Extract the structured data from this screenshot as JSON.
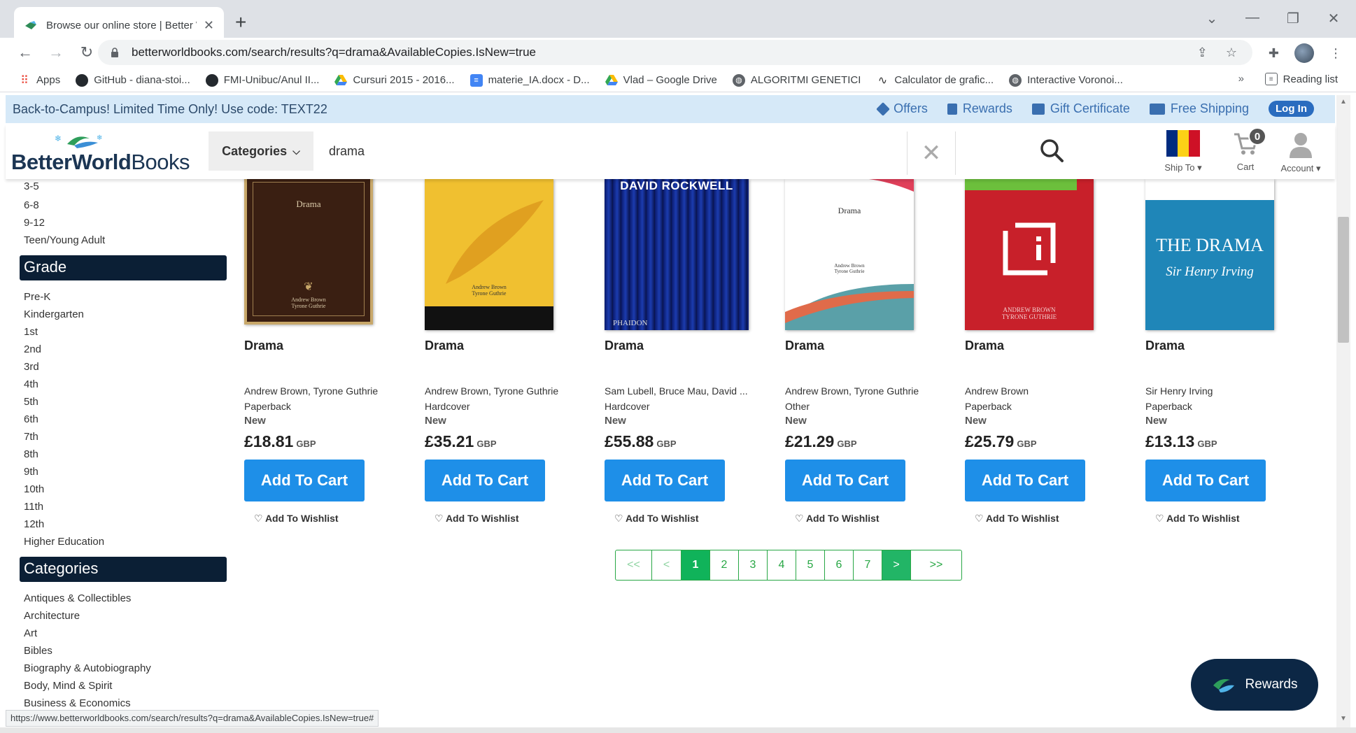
{
  "browser": {
    "tab_title": "Browse our online store | Better W",
    "url": "betterworldbooks.com/search/results?q=drama&AvailableCopies.IsNew=true",
    "bookmarks": [
      {
        "label": "Apps",
        "icon": "apps-grid-icon"
      },
      {
        "label": "GitHub - diana-stoi...",
        "icon": "github-icon"
      },
      {
        "label": "FMI-Unibuc/Anul II...",
        "icon": "github-icon"
      },
      {
        "label": "Cursuri 2015 - 2016...",
        "icon": "google-drive-icon"
      },
      {
        "label": "materie_IA.docx - D...",
        "icon": "google-docs-icon"
      },
      {
        "label": "Vlad – Google Drive",
        "icon": "google-drive-icon"
      },
      {
        "label": "ALGORITMI GENETICI",
        "icon": "globe-icon"
      },
      {
        "label": "Calculator de grafic...",
        "icon": "desmos-icon"
      },
      {
        "label": "Interactive Voronoi...",
        "icon": "globe-icon"
      }
    ],
    "bookmarks_overflow": "»",
    "reading_list": "Reading list",
    "status_url": "https://www.betterworldbooks.com/search/results?q=drama&AvailableCopies.IsNew=true#"
  },
  "promo": {
    "text": "Back-to-Campus! Limited Time Only! Use code: TEXT22",
    "links": [
      "Offers",
      "Rewards",
      "Gift Certificate",
      "Free Shipping"
    ],
    "login": "Log In"
  },
  "header": {
    "logo_bold": "BetterWorld",
    "logo_thin": "Books",
    "categories_label": "Categories",
    "search_value": "drama",
    "ship_to": "Ship To",
    "cart_label": "Cart",
    "cart_count": "0",
    "account_label": "Account"
  },
  "sidebar": {
    "age_items": [
      "3-5",
      "6-8",
      "9-12",
      "Teen/Young Adult"
    ],
    "grade_heading": "Grade",
    "grade_items": [
      "Pre-K",
      "Kindergarten",
      "1st",
      "2nd",
      "3rd",
      "4th",
      "5th",
      "6th",
      "7th",
      "8th",
      "9th",
      "10th",
      "11th",
      "12th",
      "Higher Education"
    ],
    "categories_heading": "Categories",
    "category_items": [
      "Antiques & Collectibles",
      "Architecture",
      "Art",
      "Bibles",
      "Biography & Autobiography",
      "Body, Mind & Spirit",
      "Business & Economics"
    ]
  },
  "products": [
    {
      "title": "Drama",
      "author": "Andrew Brown, Tyrone Guthrie",
      "binding": "Paperback",
      "condition": "New",
      "price": "£18.81",
      "currency": "GBP",
      "cart": "Add To Cart",
      "wishlist": "Add To Wishlist",
      "cover_title": "Drama",
      "cover_author": "Andrew Brown\nTyrone Guthrie"
    },
    {
      "title": "Drama",
      "author": "Andrew Brown, Tyrone Guthrie",
      "binding": "Hardcover",
      "condition": "New",
      "price": "£35.21",
      "currency": "GBP",
      "cart": "Add To Cart",
      "wishlist": "Add To Wishlist",
      "cover_title": "",
      "cover_author": "Andrew Brown\nTyrone Guthrie"
    },
    {
      "title": "Drama",
      "author": "Sam Lubell, Bruce Mau, David ...",
      "binding": "Hardcover",
      "condition": "New",
      "price": "£55.88",
      "currency": "GBP",
      "cart": "Add To Cart",
      "wishlist": "Add To Wishlist",
      "cover_title": "DAVID ROCKWELL",
      "cover_author": "PHAIDON"
    },
    {
      "title": "Drama",
      "author": "Andrew Brown, Tyrone Guthrie",
      "binding": "Other",
      "condition": "New",
      "price": "£21.29",
      "currency": "GBP",
      "cart": "Add To Cart",
      "wishlist": "Add To Wishlist",
      "cover_title": "Drama",
      "cover_author": "Andrew Brown\nTyrone Guthrie"
    },
    {
      "title": "Drama",
      "author": "Andrew Brown",
      "binding": "Paperback",
      "condition": "New",
      "price": "£25.79",
      "currency": "GBP",
      "cart": "Add To Cart",
      "wishlist": "Add To Wishlist",
      "cover_title": "",
      "cover_author": "ANDREW BROWN\nTYRONE GUTHRIE"
    },
    {
      "title": "Drama",
      "author": "Sir Henry Irving",
      "binding": "Paperback",
      "condition": "New",
      "price": "£13.13",
      "currency": "GBP",
      "cart": "Add To Cart",
      "wishlist": "Add To Wishlist",
      "cover_title": "THE DRAMA",
      "cover_author": "Sir Henry Irving"
    }
  ],
  "pagination": [
    "<<",
    "<",
    "1",
    "2",
    "3",
    "4",
    "5",
    "6",
    "7",
    ">",
    ">>"
  ],
  "pagination_current": "1",
  "rewards_fab": "Rewards",
  "colors": {
    "accent_blue": "#1e8fe8",
    "navy": "#0b1f35",
    "pager_green": "#28a745"
  }
}
